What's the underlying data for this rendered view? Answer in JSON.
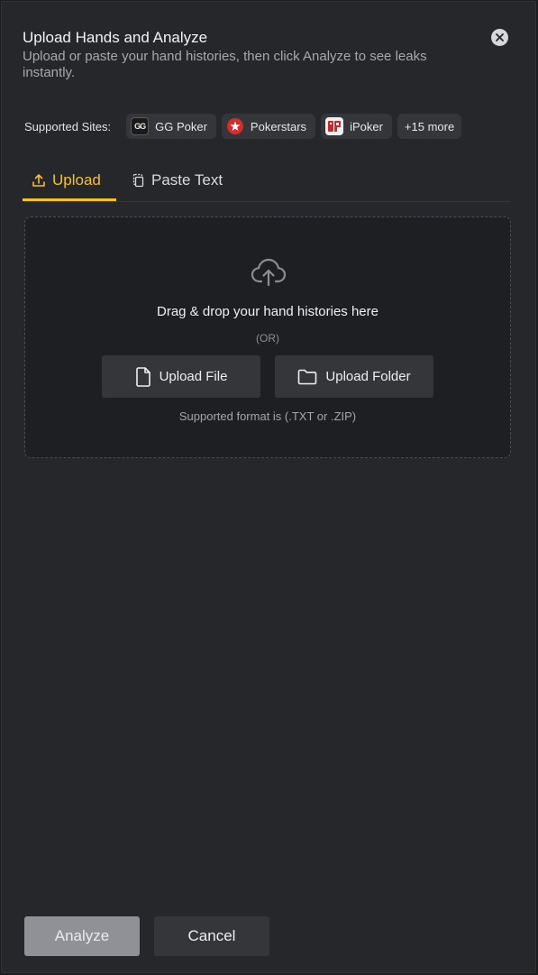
{
  "dialog": {
    "title": "Upload Hands and Analyze",
    "subtitle": "Upload or paste your hand histories, then click Analyze to see leaks instantly."
  },
  "supported_sites": {
    "label": "Supported Sites:",
    "sites": [
      {
        "name": "GG Poker",
        "icon": "gg-poker-logo"
      },
      {
        "name": "Pokerstars",
        "icon": "pokerstars-logo"
      },
      {
        "name": "iPoker",
        "icon": "ipoker-logo"
      }
    ],
    "more": "+15 more"
  },
  "tabs": [
    {
      "label": "Upload",
      "icon": "upload-icon",
      "active": true
    },
    {
      "label": "Paste Text",
      "icon": "paste-icon",
      "active": false
    }
  ],
  "dropzone": {
    "drag_text": "Drag & drop your hand histories here",
    "or_text": "(OR)",
    "upload_file_label": "Upload File",
    "upload_folder_label": "Upload Folder",
    "format_text": "Supported format is (.TXT or .ZIP)"
  },
  "footer": {
    "analyze_label": "Analyze",
    "cancel_label": "Cancel"
  },
  "colors": {
    "accent": "#f5c224",
    "panel_bg": "#25272a",
    "chip_bg": "#34363a",
    "analyze_disabled": "#8f9196"
  }
}
